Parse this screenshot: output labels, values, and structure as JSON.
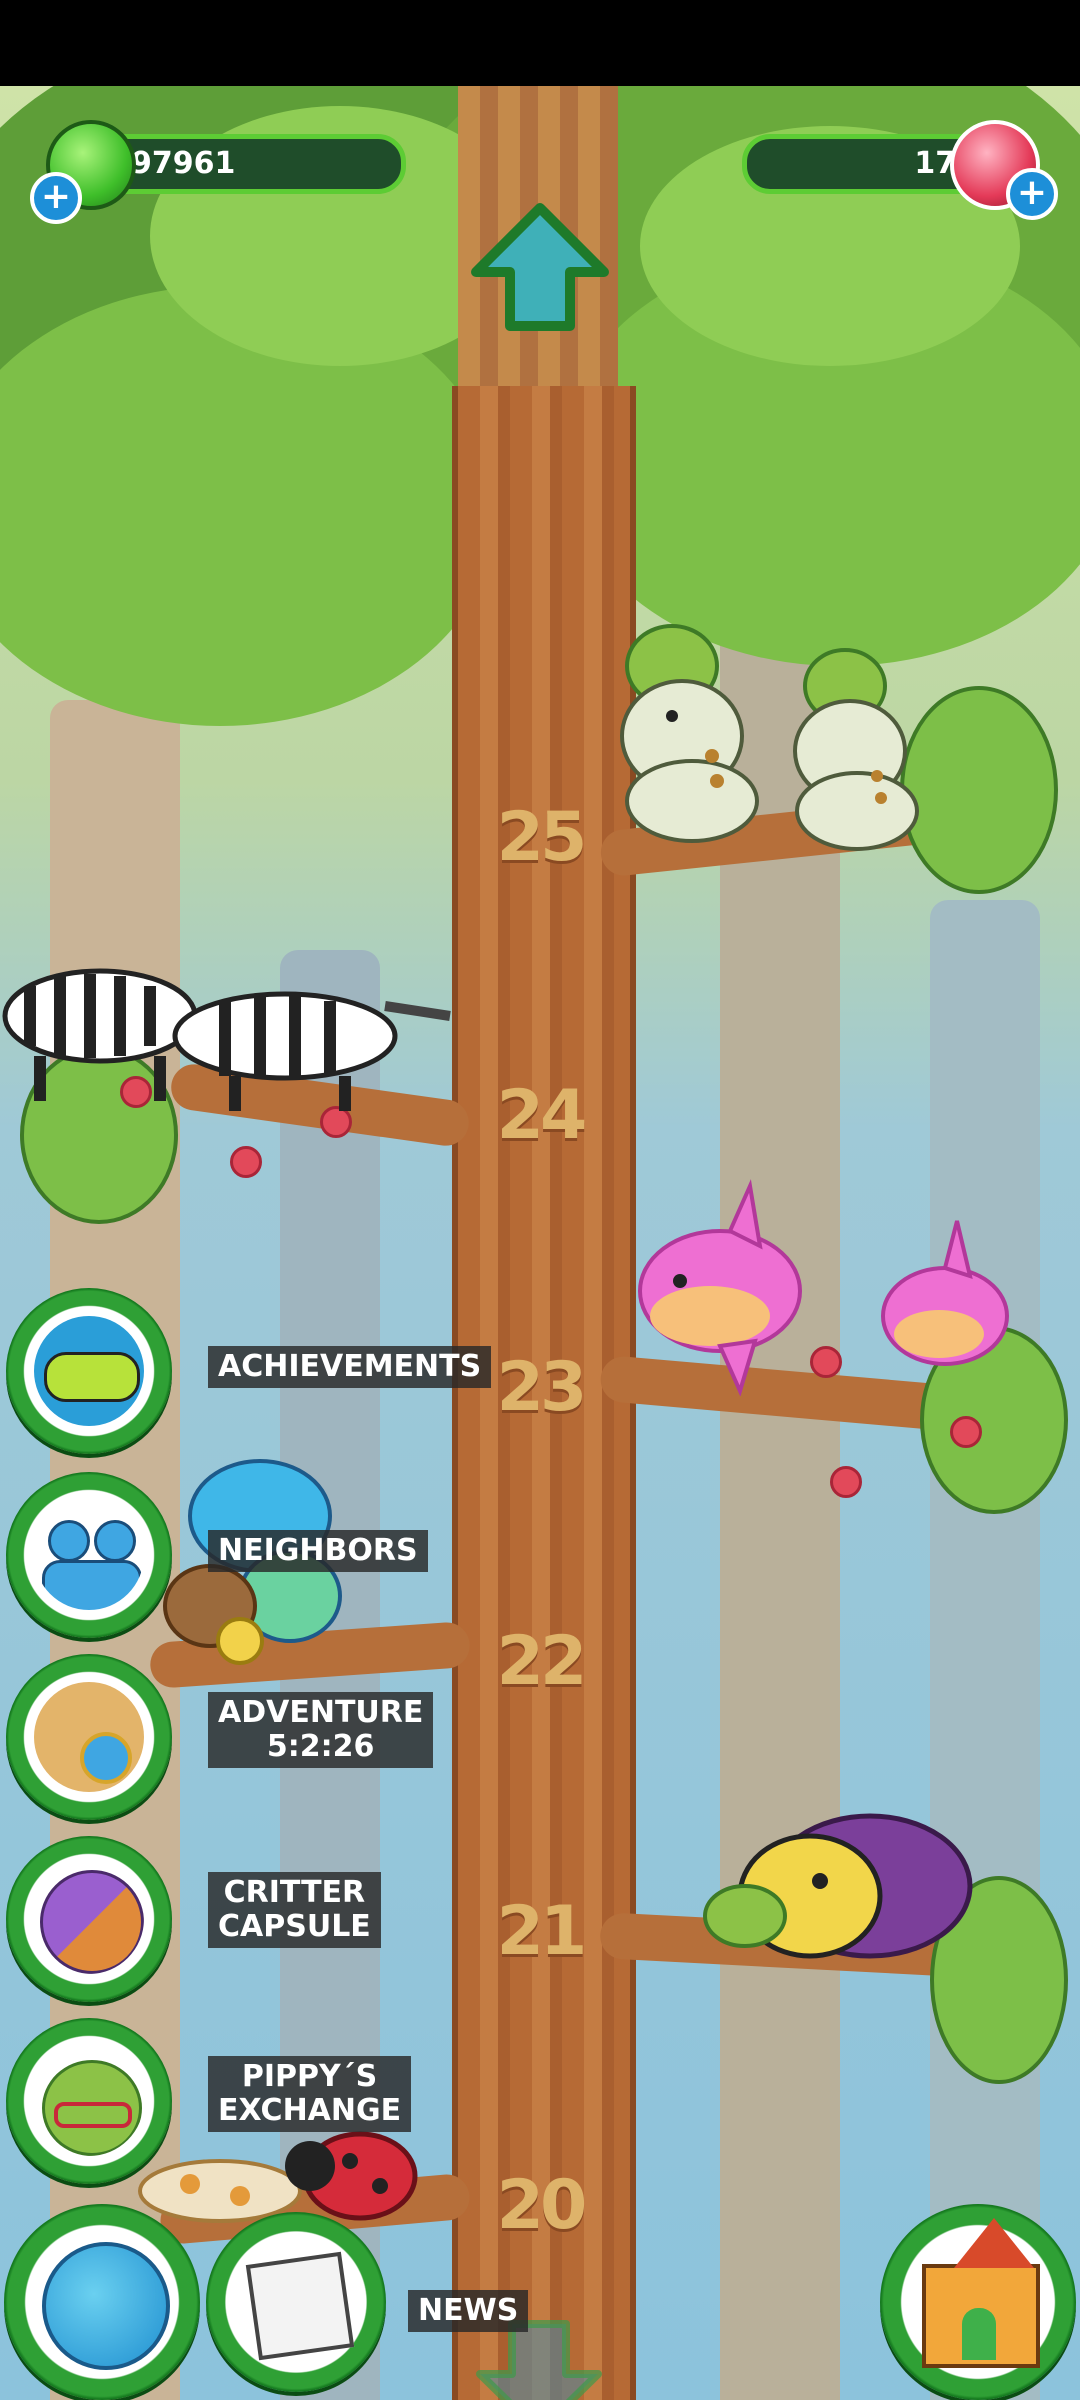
{
  "resources": {
    "food_amount": "97961",
    "gems_amount": "171",
    "food_icon": "green-gem-icon",
    "gems_icon": "red-crystal-icon",
    "add_icon": "plus-icon"
  },
  "navigation": {
    "up_icon": "arrow-up-icon",
    "down_icon": "arrow-down-icon"
  },
  "tree_levels": [
    "25",
    "24",
    "23",
    "22",
    "21",
    "20"
  ],
  "side_menu": {
    "achievements": "ACHIEVEMENTS",
    "neighbors": "NEIGHBORS",
    "adventure_line1": "ADVENTURE",
    "adventure_timer": "5:2:26",
    "critter_line1": "CRITTER",
    "critter_line2": "CAPSULE",
    "pippy_line1": "PIPPY´S",
    "pippy_line2": "EXCHANGE"
  },
  "bottom_bar": {
    "news": "NEWS",
    "globe_icon": "globe-icon",
    "news_icon": "newspaper-icon",
    "home_icon": "house-icon"
  },
  "colors": {
    "button_ring": "#2fa035",
    "label_bg": "#282828",
    "trunk": "#b66a35",
    "leaf": "#7dbf48"
  }
}
